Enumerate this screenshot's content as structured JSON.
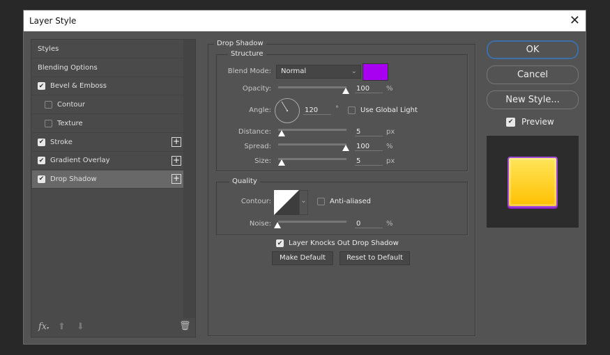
{
  "window": {
    "title": "Layer Style",
    "close_icon": "close-icon"
  },
  "sidebar": {
    "items": [
      {
        "label": "Styles",
        "checkbox": null,
        "plus": false
      },
      {
        "label": "Blending Options",
        "checkbox": null,
        "plus": false
      },
      {
        "label": "Bevel & Emboss",
        "checkbox": true,
        "plus": false
      },
      {
        "label": "Contour",
        "checkbox": false,
        "plus": false,
        "indent": true
      },
      {
        "label": "Texture",
        "checkbox": false,
        "plus": false,
        "indent": true
      },
      {
        "label": "Stroke",
        "checkbox": true,
        "plus": true
      },
      {
        "label": "Gradient Overlay",
        "checkbox": true,
        "plus": true
      },
      {
        "label": "Drop Shadow",
        "checkbox": true,
        "plus": true,
        "selected": true
      }
    ],
    "fx_label": "fx"
  },
  "drop_shadow": {
    "title": "Drop Shadow",
    "structure": {
      "title": "Structure",
      "blend_mode_label": "Blend Mode:",
      "blend_mode": "Normal",
      "shadow_color": "#a800f0",
      "opacity_label": "Opacity:",
      "opacity": "100",
      "opacity_unit": "%",
      "angle_label": "Angle:",
      "angle": "120",
      "angle_unit": "°",
      "global_light_label": "Use Global Light",
      "global_light": false,
      "distance_label": "Distance:",
      "distance": "5",
      "distance_unit": "px",
      "spread_label": "Spread:",
      "spread": "100",
      "spread_unit": "%",
      "size_label": "Size:",
      "size": "5",
      "size_unit": "px"
    },
    "quality": {
      "title": "Quality",
      "contour_label": "Contour:",
      "anti_aliased_label": "Anti-aliased",
      "anti_aliased": false,
      "noise_label": "Noise:",
      "noise": "0",
      "noise_unit": "%"
    },
    "knockout_label": "Layer Knocks Out Drop Shadow",
    "knockout": true,
    "make_default": "Make Default",
    "reset_default": "Reset to Default"
  },
  "buttons": {
    "ok": "OK",
    "cancel": "Cancel",
    "new_style": "New Style...",
    "preview_label": "Preview",
    "preview": true
  }
}
